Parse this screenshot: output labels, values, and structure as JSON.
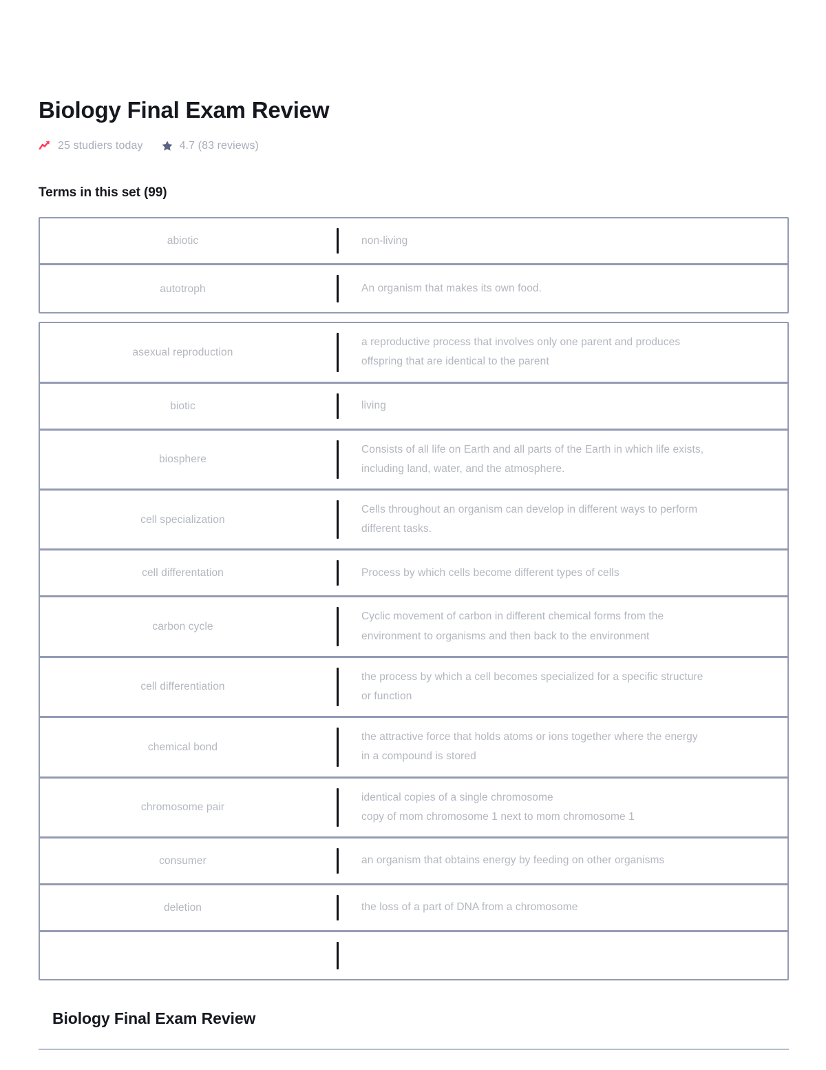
{
  "header": {
    "title": "Biology Final Exam Review",
    "studiers": {
      "icon": "trending-up-icon",
      "text": "25 studiers today",
      "color": "#ff3b5c"
    },
    "rating": {
      "icon": "star-icon",
      "text": "4.7 (83 reviews)",
      "color": "#586380"
    }
  },
  "terms_section": {
    "heading": "Terms in this set (99)",
    "groups": [
      {
        "rows": [
          {
            "term": "abiotic",
            "definition_lines": [
              "non-living"
            ]
          },
          {
            "term": "autotroph",
            "definition_lines": [
              "An organism that makes its own food."
            ]
          }
        ]
      },
      {
        "rows": [
          {
            "term": "asexual reproduction",
            "definition_lines": [
              "a reproductive process that involves only one parent and produces",
              "offspring that are identical to the parent"
            ]
          },
          {
            "term": "biotic",
            "definition_lines": [
              "living"
            ]
          },
          {
            "term": "biosphere",
            "definition_lines": [
              "Consists of all life on Earth and all parts of the Earth in which life exists,",
              "including land, water, and the atmosphere."
            ]
          },
          {
            "term": "cell specialization",
            "definition_lines": [
              "Cells throughout an organism can develop in different ways to perform",
              "different tasks."
            ]
          },
          {
            "term": "cell differentation",
            "definition_lines": [
              "Process by which cells become different types of cells"
            ]
          },
          {
            "term": "carbon cycle",
            "definition_lines": [
              "Cyclic movement of carbon in different chemical forms from the",
              "environment to organisms and then back to the environment"
            ]
          },
          {
            "term": "cell differentiation",
            "definition_lines": [
              "the process by which a cell becomes specialized for a specific structure",
              "or function"
            ]
          },
          {
            "term": "chemical bond",
            "definition_lines": [
              "the attractive force that holds atoms or ions together where the energy",
              "in a compound is stored"
            ]
          },
          {
            "term": "chromosome pair",
            "definition_lines": [
              "identical copies of a single chromosome",
              "copy of mom chromosome 1 next to mom chromosome 1"
            ]
          },
          {
            "term": "consumer",
            "definition_lines": [
              "an organism that obtains energy by feeding on other organisms"
            ]
          },
          {
            "term": "deletion",
            "definition_lines": [
              "the loss of a part of DNA from a chromosome"
            ]
          }
        ]
      }
    ]
  },
  "footer": {
    "title": "Biology Final Exam Review"
  }
}
